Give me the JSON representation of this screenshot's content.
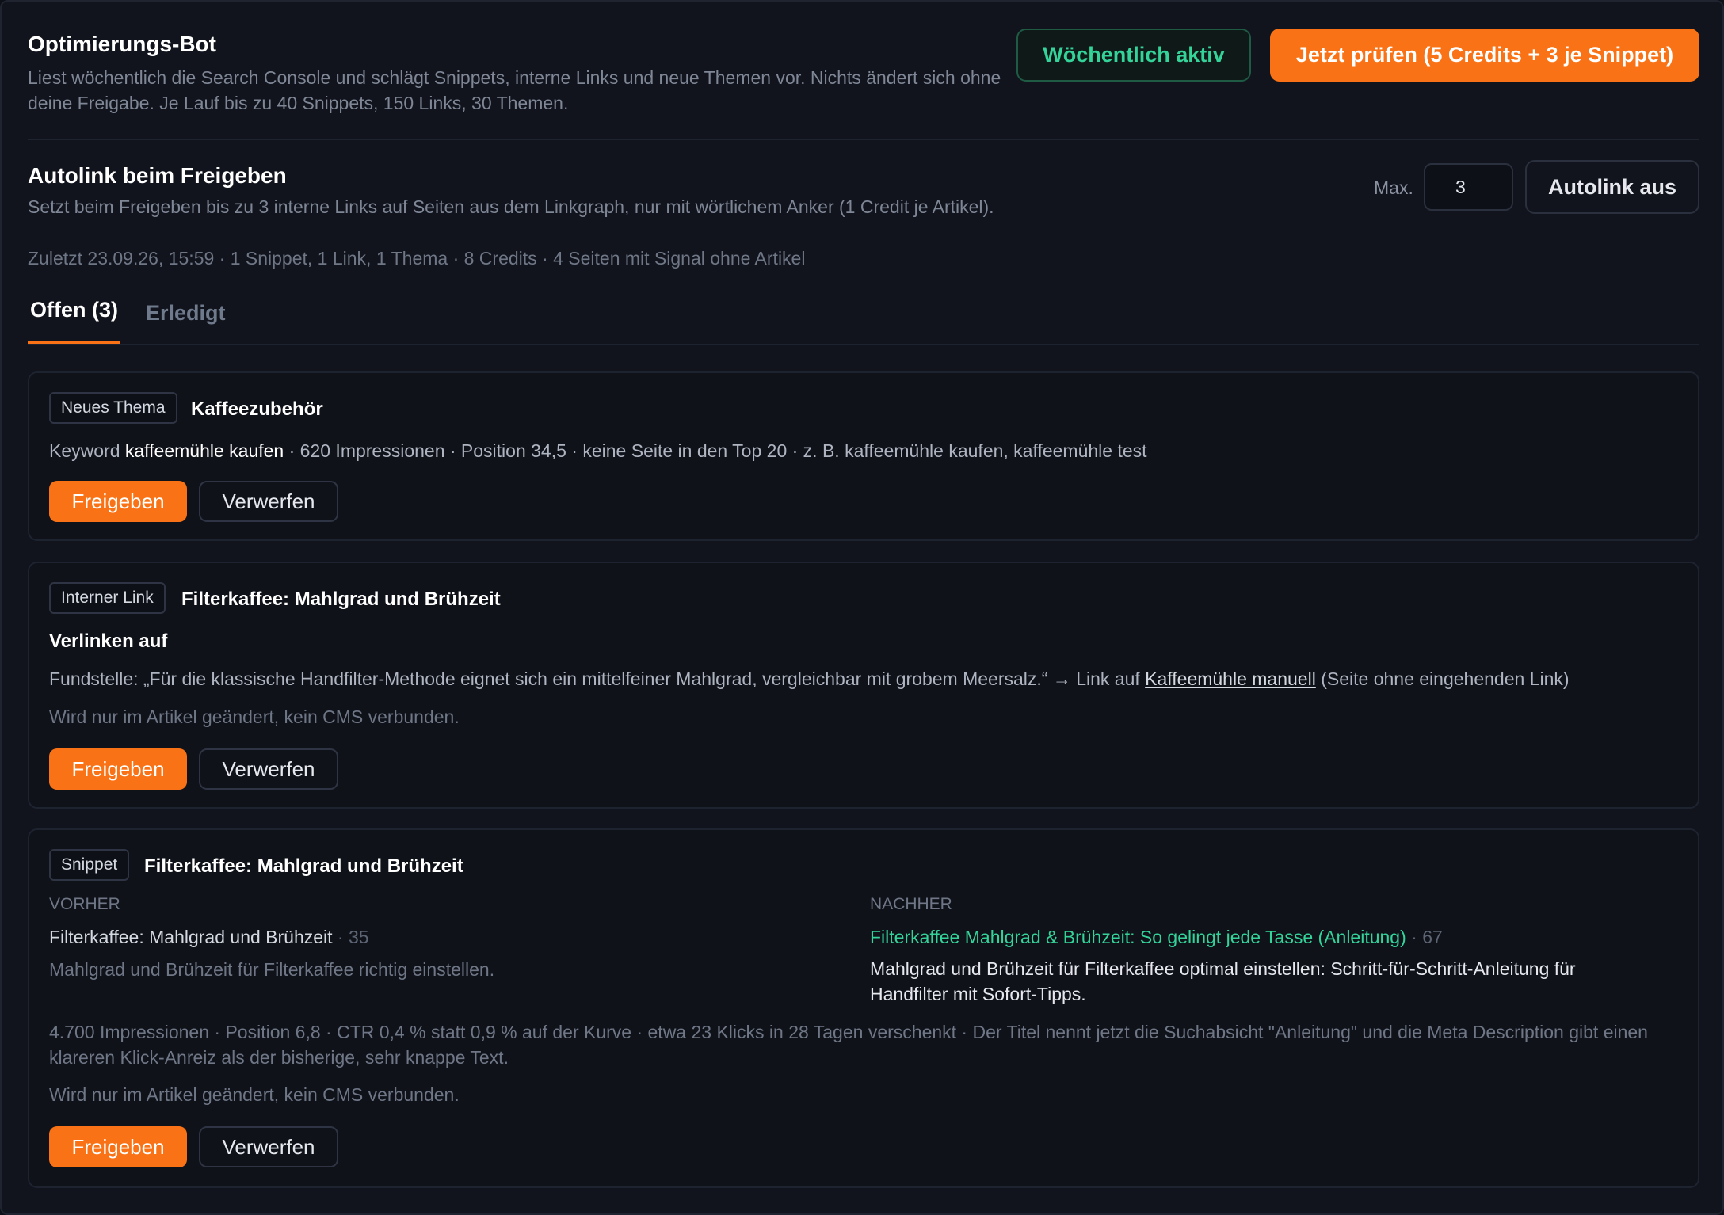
{
  "bot": {
    "title": "Optimierungs-Bot",
    "description": "Liest wöchentlich die Search Console und schlägt Snippets, interne Links und neue Themen vor. Nichts ändert sich ohne deine Freigabe. Je Lauf bis zu 40 Snippets, 150 Links, 30 Themen.",
    "weekly_label": "Wöchentlich aktiv",
    "check_label": "Jetzt prüfen (5 Credits + 3 je Snippet)",
    "accent_color": "#f97316",
    "success_color": "#34d399"
  },
  "autolink": {
    "title": "Autolink beim Freigeben",
    "description": "Setzt beim Freigeben bis zu 3 interne Links auf Seiten aus dem Linkgraph, nur mit wörtlichem Anker (1 Credit je Artikel).",
    "max_label": "Max.",
    "max_value": "3",
    "toggle_label": "Autolink aus",
    "last_run": "Zuletzt 23.09.26, 15:59 · 1 Snippet, 1 Link, 1 Thema · 8 Credits · 4 Seiten mit Signal ohne Artikel"
  },
  "tabs": {
    "open": "Offen (3)",
    "done": "Erledigt"
  },
  "cards": [
    {
      "badge": "Neues Thema",
      "title": "Kaffeezubehör",
      "keyword_prefix": "Keyword ",
      "keyword": "kaffeemühle kaufen",
      "keyword_suffix": " · 620 Impressionen · Position 34,5 · keine Seite in den Top 20 · z. B. kaffeemühle kaufen, kaffeemühle test",
      "approve": "Freigeben",
      "discard": "Verwerfen"
    },
    {
      "badge": "Interner Link",
      "title": "Filterkaffee: Mahlgrad und Brühzeit",
      "sub_heading": "Verlinken auf",
      "finding_prefix": "Fundstelle: „Für die klassische Handfilter-Methode eignet sich ein mittelfeiner Mahlgrad, vergleichbar mit grobem Meersalz.“ → Link auf ",
      "finding_link": "Kaffeemühle manuell",
      "finding_suffix": " (Seite ohne eingehenden Link)",
      "note": "Wird nur im Artikel geändert, kein CMS verbunden.",
      "approve": "Freigeben",
      "discard": "Verwerfen"
    },
    {
      "badge": "Snippet",
      "title": "Filterkaffee: Mahlgrad und Brühzeit",
      "before_label": "Vorher",
      "after_label": "Nachher",
      "before_title": "Filterkaffee: Mahlgrad und Brühzeit",
      "before_count": " · 35",
      "before_desc": "Mahlgrad und Brühzeit für Filterkaffee richtig einstellen.",
      "after_title": "Filterkaffee Mahlgrad & Brühzeit: So gelingt jede Tasse (Anleitung)",
      "after_count": " · 67",
      "after_desc": "Mahlgrad und Brühzeit für Filterkaffee optimal einstellen: Schritt-für-Schritt-Anleitung für Handfilter mit Sofort-Tipps.",
      "reason": "4.700 Impressionen · Position 6,8 · CTR 0,4 % statt 0,9 % auf der Kurve · etwa 23 Klicks in 28 Tagen verschenkt · Der Titel nennt jetzt die Suchabsicht \"Anleitung\" und die Meta Description gibt einen klareren Klick-Anreiz als der bisherige, sehr knappe Text.",
      "note": "Wird nur im Artikel geändert, kein CMS verbunden.",
      "approve": "Freigeben",
      "discard": "Verwerfen"
    }
  ]
}
